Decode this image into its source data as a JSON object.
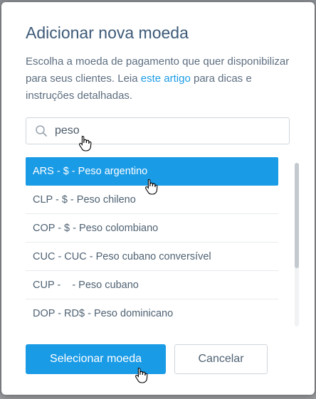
{
  "modal": {
    "title": "Adicionar nova moeda",
    "description_prefix": "Escolha a moeda de pagamento que quer disponibilizar para seus clientes. Leia ",
    "description_link": "este artigo",
    "description_suffix": " para dicas e instruções detalhadas."
  },
  "search": {
    "value": "peso",
    "icon": "search-icon"
  },
  "currencies": [
    {
      "label": "ARS - $ - Peso argentino",
      "selected": true
    },
    {
      "label": "CLP - $ - Peso chileno",
      "selected": false
    },
    {
      "label": "COP - $ - Peso colombiano",
      "selected": false
    },
    {
      "label": "CUC - CUC - Peso cubano conversível",
      "selected": false
    },
    {
      "label": "CUP -    - Peso cubano",
      "selected": false
    },
    {
      "label": "DOP - RD$ - Peso dominicano",
      "selected": false
    }
  ],
  "buttons": {
    "select_label": "Selecionar moeda",
    "cancel_label": "Cancelar"
  },
  "colors": {
    "primary": "#1a9be6",
    "title": "#3d5a78",
    "text": "#5d6e80"
  }
}
